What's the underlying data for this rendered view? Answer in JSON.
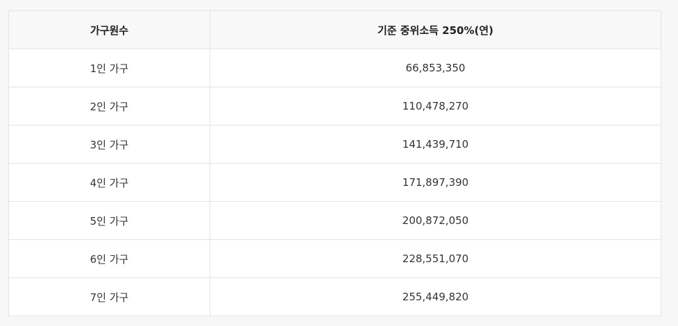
{
  "table": {
    "headers": [
      "가구원수",
      "기준 중위소득 250%(연)"
    ],
    "rows": [
      [
        "1인 가구",
        "66,853,350"
      ],
      [
        "2인 가구",
        "110,478,270"
      ],
      [
        "3인 가구",
        "141,439,710"
      ],
      [
        "4인 가구",
        "171,897,390"
      ],
      [
        "5인 가구",
        "200,872,050"
      ],
      [
        "6인 가구",
        "228,551,070"
      ],
      [
        "7인 가구",
        "255,449,820"
      ]
    ]
  }
}
